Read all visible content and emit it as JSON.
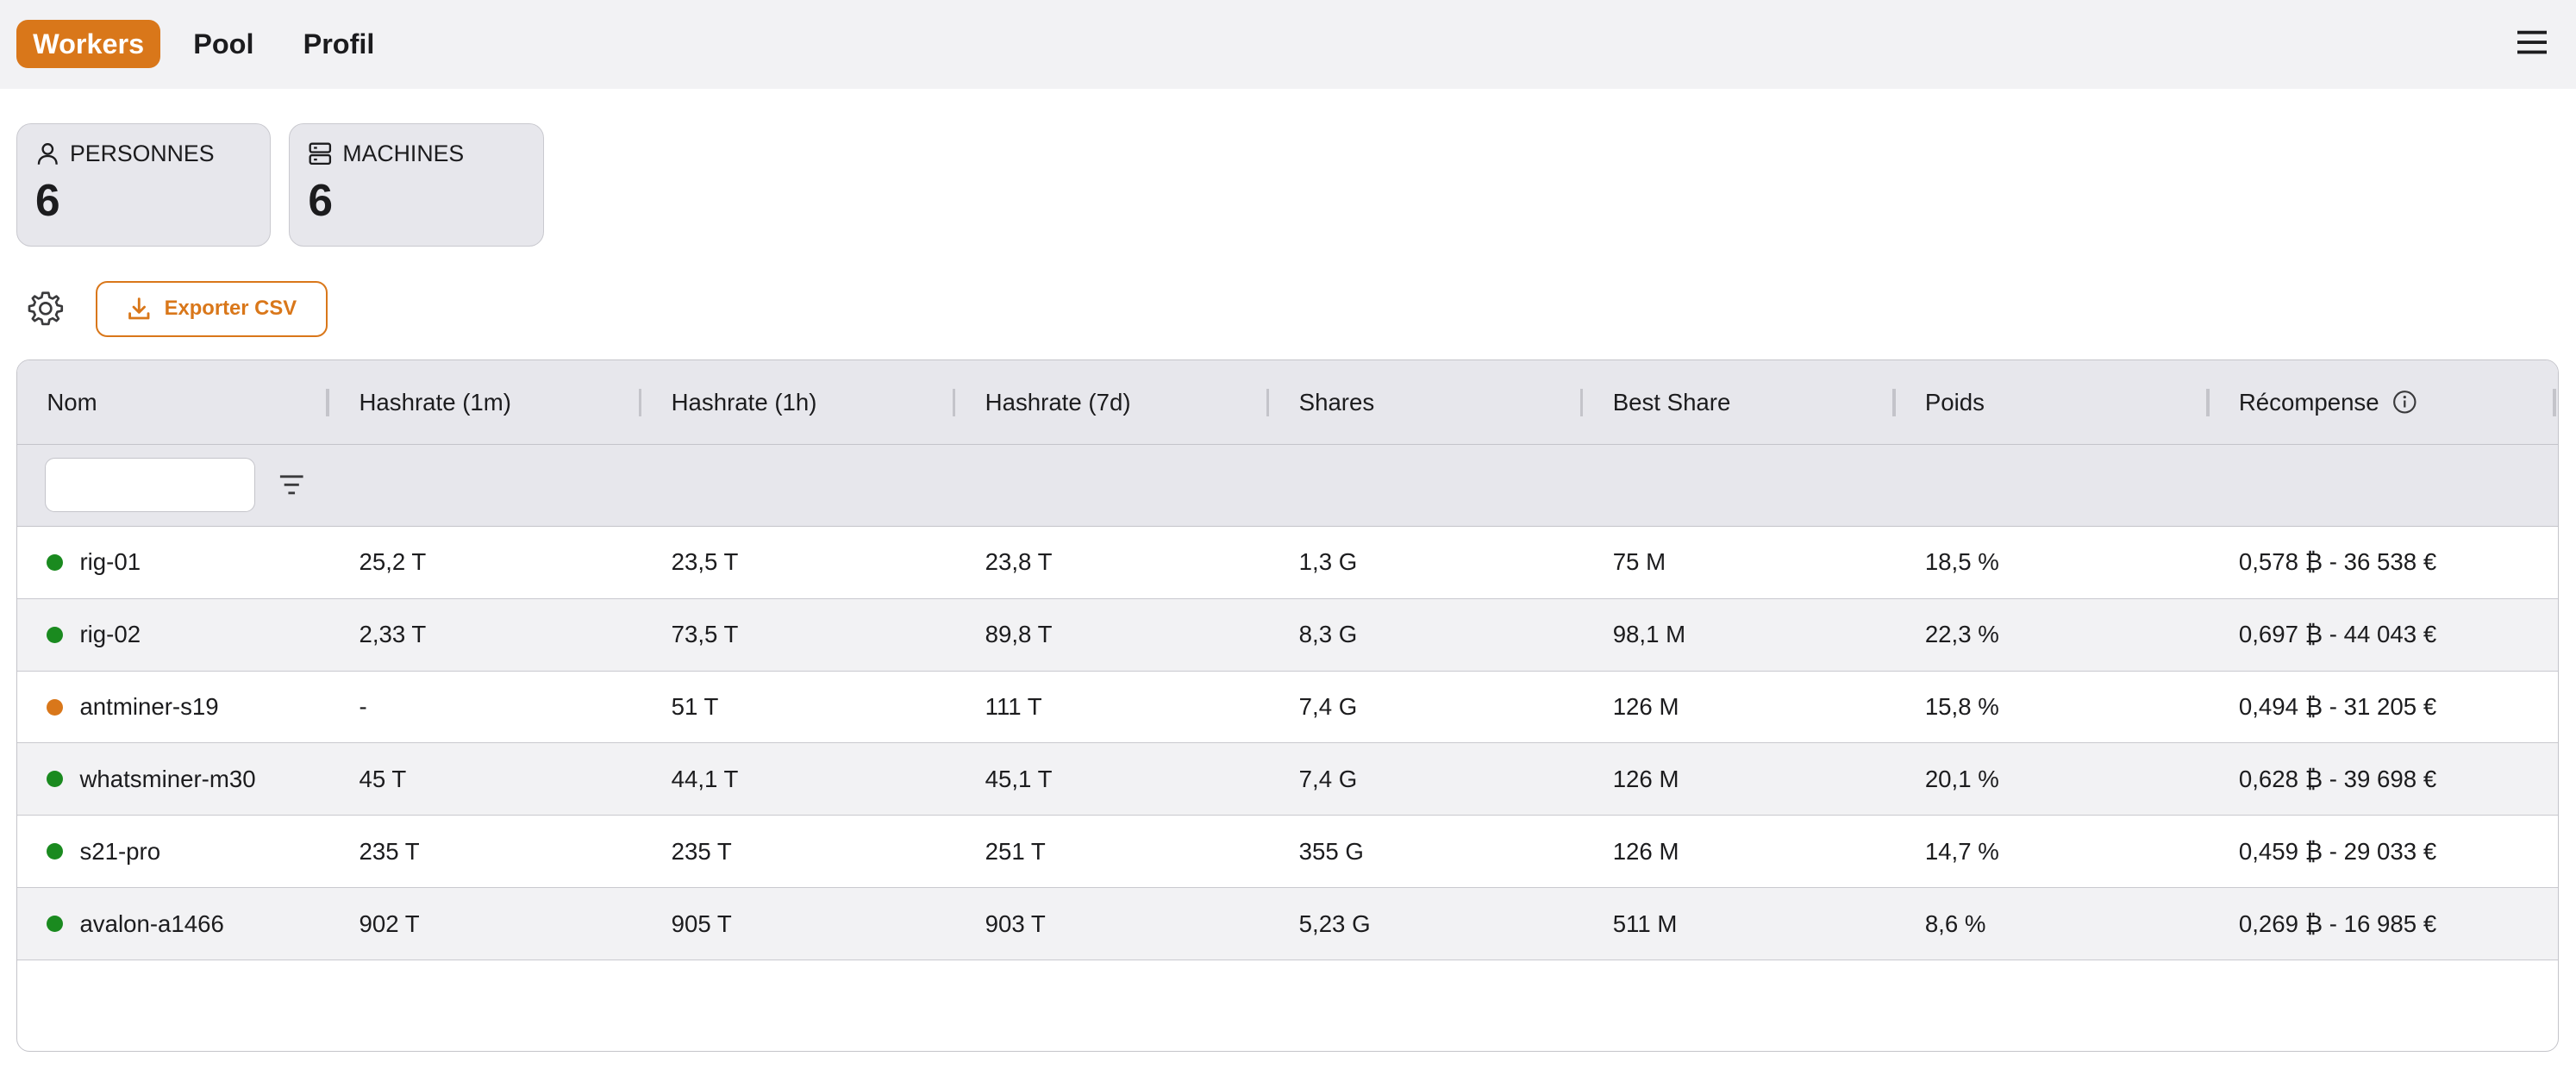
{
  "nav": {
    "tabs": [
      {
        "label": "Workers",
        "active": true
      },
      {
        "label": "Pool",
        "active": false
      },
      {
        "label": "Profil",
        "active": false
      }
    ],
    "menu_icon": "hamburger-menu-icon"
  },
  "stats": {
    "persons": {
      "label": "PERSONNES",
      "value": "6",
      "icon": "user-icon"
    },
    "machines": {
      "label": "MACHINES",
      "value": "6",
      "icon": "server-icon"
    }
  },
  "toolbar": {
    "settings_icon": "gear-icon",
    "export_label": "Exporter CSV",
    "export_icon": "download-icon"
  },
  "table": {
    "columns": [
      "Nom",
      "Hashrate (1m)",
      "Hashrate (1h)",
      "Hashrate (7d)",
      "Shares",
      "Best Share",
      "Poids",
      "Récompense"
    ],
    "filter_value": "",
    "rows": [
      {
        "status": "online",
        "name": "rig-01",
        "h1m": "25,2 T",
        "h1h": "23,5 T",
        "h7d": "23,8 T",
        "shares": "1,3 G",
        "best": "75 M",
        "weight": "18,5 %",
        "reward": "0,578 ₿ - 36 538 €"
      },
      {
        "status": "online",
        "name": "rig-02",
        "h1m": "2,33 T",
        "h1h": "73,5 T",
        "h7d": "89,8 T",
        "shares": "8,3 G",
        "best": "98,1 M",
        "weight": "22,3 %",
        "reward": "0,697 ₿ - 44 043 €"
      },
      {
        "status": "warning",
        "name": "antminer-s19",
        "h1m": "-",
        "h1h": "51 T",
        "h7d": "111 T",
        "shares": "7,4 G",
        "best": "126 M",
        "weight": "15,8 %",
        "reward": "0,494 ₿ - 31 205 €"
      },
      {
        "status": "online",
        "name": "whatsminer-m30",
        "h1m": "45 T",
        "h1h": "44,1 T",
        "h7d": "45,1 T",
        "shares": "7,4 G",
        "best": "126 M",
        "weight": "20,1 %",
        "reward": "0,628 ₿ - 39 698 €"
      },
      {
        "status": "online",
        "name": "s21-pro",
        "h1m": "235 T",
        "h1h": "235 T",
        "h7d": "251 T",
        "shares": "355 G",
        "best": "126 M",
        "weight": "14,7 %",
        "reward": "0,459 ₿ - 29 033 €"
      },
      {
        "status": "online",
        "name": "avalon-a1466",
        "h1m": "902 T",
        "h1h": "905 T",
        "h7d": "903 T",
        "shares": "5,23 G",
        "best": "511 M",
        "weight": "8,6 %",
        "reward": "0,269 ₿ - 16 985 €"
      }
    ]
  },
  "colors": {
    "accent": "#d9771a",
    "online": "#1a8a1f",
    "warning": "#d9771a"
  }
}
